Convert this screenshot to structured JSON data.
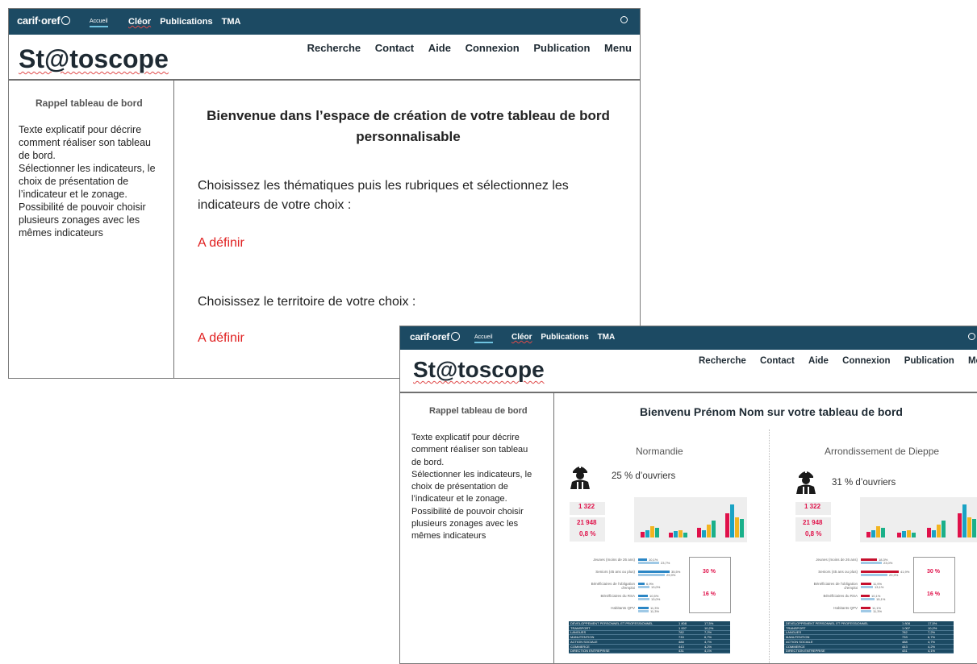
{
  "topbar": {
    "logo": "carif·oref",
    "accueil": "Accueil",
    "links": [
      "Cléor",
      "Publications",
      "TMA"
    ]
  },
  "brand": "St@toscope",
  "main_nav": [
    "Recherche",
    "Contact",
    "Aide",
    "Connexion",
    "Publication",
    "Menu"
  ],
  "sidebar": {
    "title": "Rappel tableau de bord",
    "text": "Texte explicatif pour décrire\ncomment réaliser son tableau\nde bord.\nSélectionner les indicateurs, le\nchoix de présentation de\nl’indicateur et le zonage.\nPossibilité de pouvoir choisir\nplusieurs zonages avec les\nmêmes indicateurs"
  },
  "creation_page": {
    "heading": "Bienvenue dans l’espace de création de votre tableau de bord personnalisable",
    "instruction_themes": "Choisissez les thématiques puis les rubriques et sélectionnez les indicateurs de votre choix :",
    "themes_value": "A définir",
    "instruction_territory": "Choisissez le territoire de votre choix :",
    "territory_value": "A définir"
  },
  "dashboard_page": {
    "heading": "Bienvenu Prénom Nom sur votre tableau de bord",
    "panels": [
      {
        "region": "Normandie",
        "stat": "25 % d’ouvriers",
        "kpis": [
          "1 322",
          "21 948",
          "0,8 %"
        ],
        "hbars": [
          {
            "label": "Jeunes (moins de 26 ans)",
            "v1": "10,1%",
            "v2": "23,7%"
          },
          {
            "label": "Seniors (45 ans ou plus)",
            "v1": "35,5%",
            "v2": "29,9%"
          },
          {
            "label": "Bénéficiaires de l'obligation d'emploi",
            "v1": "6,9%",
            "v2": "13,0%"
          },
          {
            "label": "Bénéficiaires du RSA",
            "v1": "10,5%",
            "v2": "13,0%"
          },
          {
            "label": "Habitants QPV",
            "v1": "11,3%",
            "v2": "11,3%"
          }
        ],
        "info_pcts": [
          "30 %",
          "16 %"
        ],
        "table": [
          [
            "DEVELOPPEMENT PERSONNEL ET PROFESSIONNEL",
            "1 808",
            "17,5%"
          ],
          [
            "TRANSPORT",
            "1 007",
            "10,2%"
          ],
          [
            "LANGUES",
            "782",
            "7,2%"
          ],
          [
            "MANUTENTION",
            "733",
            "6,7%"
          ],
          [
            "ACTION SOCIALE",
            "488",
            "4,7%"
          ],
          [
            "COMMERCE",
            "443",
            "4,2%"
          ],
          [
            "DIRECTION ENTREPRISE",
            "431",
            "4,1%"
          ]
        ]
      },
      {
        "region": "Arrondissement de Dieppe",
        "stat": "31 % d’ouvriers",
        "kpis": [
          "1 322",
          "21 948",
          "0,8 %"
        ],
        "hbars": [
          {
            "label": "Jeunes (moins de 26 ans)",
            "v1": "18,3%",
            "v2": "23,0%"
          },
          {
            "label": "Seniors (45 ans ou plus)",
            "v1": "41,9%",
            "v2": "29,9%"
          },
          {
            "label": "Bénéficiaires de l'obligation d'emploi",
            "v1": "11,9%",
            "v2": "13,1%"
          },
          {
            "label": "Bénéficiaires du RSA",
            "v1": "10,1%",
            "v2": "15,1%"
          },
          {
            "label": "Habitants QPV",
            "v1": "11,1%",
            "v2": "11,3%"
          }
        ],
        "info_pcts": [
          "30 %",
          "16 %"
        ],
        "table": [
          [
            "DEVELOPPEMENT PERSONNEL ET PROFESSIONNEL",
            "1 808",
            "17,5%"
          ],
          [
            "TRANSPORT",
            "1 007",
            "10,2%"
          ],
          [
            "LANGUES",
            "782",
            "7,2%"
          ],
          [
            "MANUTENTION",
            "733",
            "6,7%"
          ],
          [
            "ACTION SOCIALE",
            "488",
            "4,7%"
          ],
          [
            "COMMERCE",
            "443",
            "4,2%"
          ],
          [
            "DIRECTION ENTREPRISE",
            "431",
            "4,1%"
          ]
        ]
      }
    ],
    "bar_colors": [
      "#e0114a",
      "#1aa3c4",
      "#f2b420",
      "#1ab08a"
    ],
    "mini_bar_values": [
      [
        0.15,
        0.2,
        0.3,
        0.25
      ],
      [
        0.12,
        0.17,
        0.2,
        0.14
      ],
      [
        0.25,
        0.2,
        0.35,
        0.45
      ],
      [
        0.65,
        0.9,
        0.55,
        0.5
      ]
    ]
  },
  "colors": {
    "topbar": "#1c4a63",
    "accent_red": "#e02020",
    "kpi_pink": "#e0114a",
    "hbar_blue": "#2b86c5",
    "hbar_light": "#9fc9e6",
    "hbar_red": "#c6102e"
  }
}
